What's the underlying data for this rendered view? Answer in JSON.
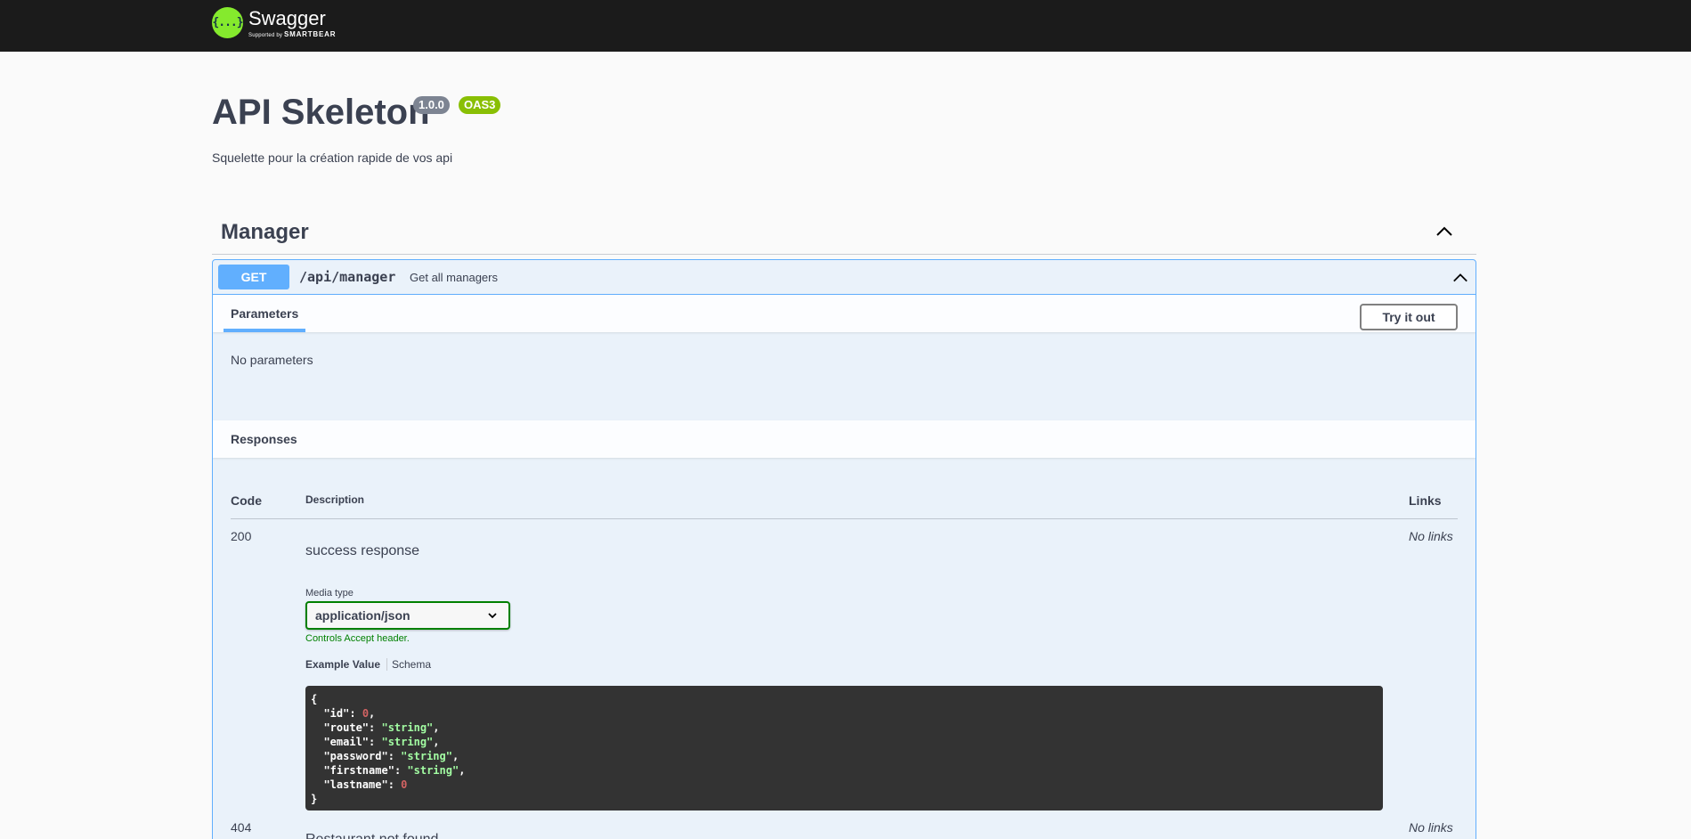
{
  "topbar": {
    "logo_glyph": "{...}",
    "logo_name": "Swagger",
    "logo_sub_prefix": "Supported by ",
    "logo_sub_brand": "SMARTBEAR",
    "background": "#1b1b1b",
    "logo_color": "#85ea2d"
  },
  "info": {
    "title": "API Skeleton",
    "version": "1.0.0",
    "oas": "OAS3",
    "description": "Squelette pour la création rapide de vos api"
  },
  "tag": {
    "name": "Manager",
    "toggle_icon": "chevron-up-icon"
  },
  "operation": {
    "method": "GET",
    "method_color": "#61affe",
    "path": "/api/manager",
    "summary": "Get all managers",
    "toggle_icon": "chevron-up-icon"
  },
  "parameters": {
    "tab_label": "Parameters",
    "try_button": "Try it out",
    "empty_text": "No parameters"
  },
  "responses": {
    "title": "Responses",
    "columns": {
      "code": "Code",
      "description": "Description",
      "links": "Links"
    },
    "items": [
      {
        "code": "200",
        "description": "success response",
        "links": "No links",
        "media_type_label": "Media type",
        "media_type_value": "application/json",
        "media_hint": "Controls Accept header.",
        "example_tab": "Example Value",
        "schema_tab": "Schema",
        "example": {
          "open": "{",
          "lines": [
            {
              "key": "\"id\"",
              "value": "0",
              "kind": "num",
              "comma": ","
            },
            {
              "key": "\"route\"",
              "value": "\"string\"",
              "kind": "str",
              "comma": ","
            },
            {
              "key": "\"email\"",
              "value": "\"string\"",
              "kind": "str",
              "comma": ","
            },
            {
              "key": "\"password\"",
              "value": "\"string\"",
              "kind": "str",
              "comma": ","
            },
            {
              "key": "\"firstname\"",
              "value": "\"string\"",
              "kind": "str",
              "comma": ","
            },
            {
              "key": "\"lastname\"",
              "value": "0",
              "kind": "num",
              "comma": ""
            }
          ],
          "close": "}"
        }
      },
      {
        "code": "404",
        "description": "Restaurant not found",
        "links": "No links"
      }
    ]
  }
}
